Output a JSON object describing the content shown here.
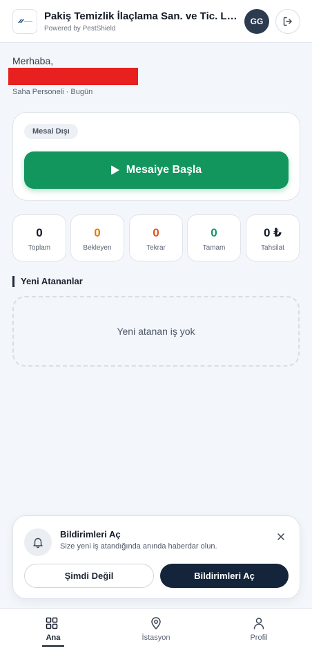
{
  "header": {
    "company_name": "Pakiş Temizlik İlaçlama San. ve Tic. Ltd. Şti.",
    "powered_by": "Powered by PestShield",
    "avatar_initials": "GG"
  },
  "greeting": {
    "hello": "Merhaba,",
    "role_date": "Saha Personeli · Bugün"
  },
  "shift": {
    "status": "Mesai Dışı",
    "start_label": "Mesaiye Başla"
  },
  "stats": [
    {
      "value": "0",
      "label": "Toplam",
      "color": "#141b27"
    },
    {
      "value": "0",
      "label": "Bekleyen",
      "color": "#e07b0c"
    },
    {
      "value": "0",
      "label": "Tekrar",
      "color": "#e2521e"
    },
    {
      "value": "0",
      "label": "Tamam",
      "color": "#14946a"
    },
    {
      "value": "0 ₺",
      "label": "Tahsilat",
      "color": "#141b27"
    }
  ],
  "assignments": {
    "title": "Yeni Atananlar",
    "empty_text": "Yeni atanan iş yok"
  },
  "notification": {
    "title": "Bildirimleri Aç",
    "description": "Size yeni iş atandığında anında haberdar olun.",
    "later_label": "Şimdi Değil",
    "enable_label": "Bildirimleri Aç"
  },
  "nav": {
    "items": [
      {
        "label": "Ana",
        "icon": "grid-icon"
      },
      {
        "label": "İstasyon",
        "icon": "location-pin-icon"
      },
      {
        "label": "Profil",
        "icon": "user-icon"
      }
    ]
  },
  "colors": {
    "accent_green": "#13955e",
    "dark_navy": "#14243a",
    "redaction": "#e8201f"
  }
}
